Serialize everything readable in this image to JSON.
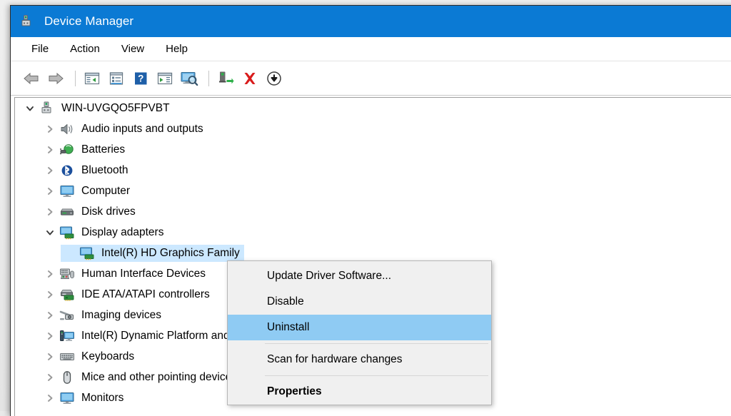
{
  "window": {
    "title": "Device Manager",
    "icon": "device-manager-icon"
  },
  "menubar": {
    "items": [
      {
        "label": "File"
      },
      {
        "label": "Action"
      },
      {
        "label": "View"
      },
      {
        "label": "Help"
      }
    ]
  },
  "toolbar": {
    "buttons": [
      {
        "name": "back-button",
        "icon": "back-arrow-icon",
        "label": "Back"
      },
      {
        "name": "forward-button",
        "icon": "forward-arrow-icon",
        "label": "Forward"
      },
      {
        "name": "separator-1",
        "icon": "separator",
        "label": ""
      },
      {
        "name": "show-hide-console-tree-button",
        "icon": "console-tree-icon",
        "label": "Show/Hide Console Tree"
      },
      {
        "name": "properties-button",
        "icon": "properties-icon",
        "label": "Properties"
      },
      {
        "name": "help-button",
        "icon": "help-question-icon",
        "label": "Help"
      },
      {
        "name": "show-hide-action-pane-button",
        "icon": "action-pane-icon",
        "label": "Show/Hide Action Pane"
      },
      {
        "name": "scan-for-hardware-changes-button",
        "icon": "scan-hardware-icon",
        "label": "Scan for hardware changes"
      },
      {
        "name": "separator-2",
        "icon": "separator",
        "label": ""
      },
      {
        "name": "update-driver-button",
        "icon": "update-driver-icon",
        "label": "Update Driver Software"
      },
      {
        "name": "uninstall-button",
        "icon": "red-x-icon",
        "label": "Uninstall"
      },
      {
        "name": "disable-button",
        "icon": "disable-down-arrow-icon",
        "label": "Disable"
      }
    ]
  },
  "tree": {
    "root": {
      "label": "WIN-UVGQO5FPVBT",
      "icon": "computer-root-icon",
      "expanded": true
    },
    "nodes": [
      {
        "label": "Audio inputs and outputs",
        "icon": "speaker-icon",
        "expanded": false,
        "selected": false,
        "indent": 1
      },
      {
        "label": "Batteries",
        "icon": "battery-icon",
        "expanded": false,
        "selected": false,
        "indent": 1
      },
      {
        "label": "Bluetooth",
        "icon": "bluetooth-icon",
        "expanded": false,
        "selected": false,
        "indent": 1
      },
      {
        "label": "Computer",
        "icon": "monitor-icon",
        "expanded": false,
        "selected": false,
        "indent": 1
      },
      {
        "label": "Disk drives",
        "icon": "disk-drive-icon",
        "expanded": false,
        "selected": false,
        "indent": 1
      },
      {
        "label": "Display adapters",
        "icon": "display-adapter-icon",
        "expanded": true,
        "selected": false,
        "indent": 1
      },
      {
        "label": "Intel(R) HD Graphics Family",
        "icon": "display-adapter-icon",
        "expanded": null,
        "selected": true,
        "indent": 2
      },
      {
        "label": "Human Interface Devices",
        "icon": "hid-icon",
        "expanded": false,
        "selected": false,
        "indent": 1
      },
      {
        "label": "IDE ATA/ATAPI controllers",
        "icon": "ide-controller-icon",
        "expanded": false,
        "selected": false,
        "indent": 1
      },
      {
        "label": "Imaging devices",
        "icon": "imaging-device-icon",
        "expanded": false,
        "selected": false,
        "indent": 1
      },
      {
        "label": "Intel(R) Dynamic Platform and Thermal Framework",
        "icon": "intel-dptf-icon",
        "expanded": false,
        "selected": false,
        "indent": 1
      },
      {
        "label": "Keyboards",
        "icon": "keyboard-icon",
        "expanded": false,
        "selected": false,
        "indent": 1
      },
      {
        "label": "Mice and other pointing devices",
        "icon": "mouse-icon",
        "expanded": false,
        "selected": false,
        "indent": 1
      },
      {
        "label": "Monitors",
        "icon": "monitor-icon",
        "expanded": false,
        "selected": false,
        "indent": 1
      }
    ]
  },
  "context_menu": {
    "items": [
      {
        "type": "item",
        "label": "Update Driver Software...",
        "highlighted": false,
        "bold": false
      },
      {
        "type": "item",
        "label": "Disable",
        "highlighted": false,
        "bold": false
      },
      {
        "type": "item",
        "label": "Uninstall",
        "highlighted": true,
        "bold": false
      },
      {
        "type": "separator"
      },
      {
        "type": "item",
        "label": "Scan for hardware changes",
        "highlighted": false,
        "bold": false
      },
      {
        "type": "separator"
      },
      {
        "type": "item",
        "label": "Properties",
        "highlighted": false,
        "bold": true
      }
    ]
  },
  "colors": {
    "titlebar": "#0b7ad4",
    "selection": "#cce8ff",
    "menu_highlight": "#8fcbf3",
    "menu_background": "#f0f0f0",
    "window_background": "#ffffff"
  }
}
